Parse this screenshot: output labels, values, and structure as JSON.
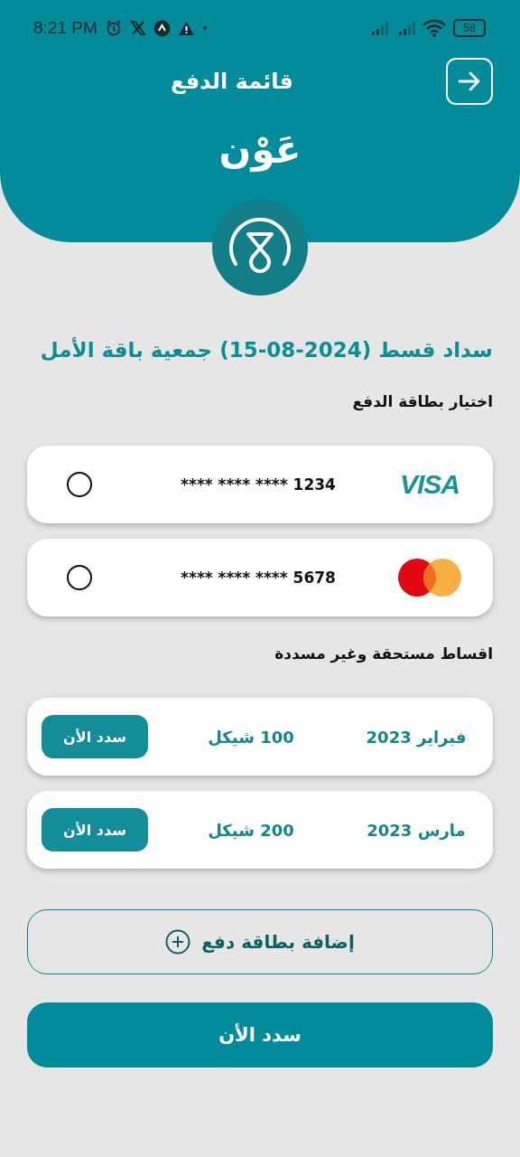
{
  "status_bar": {
    "time": "8:21 PM",
    "battery": "58"
  },
  "header": {
    "title": "قائمة الدفع",
    "logo_text": "عَوْن"
  },
  "payment_title": "سداد قسط (15-08-2024) جمعية باقة الأمل",
  "cards_heading": "اختيار بطاقة الدفع",
  "cards": [
    {
      "kind": "visa",
      "brand": "VISA",
      "number": "**** **** **** 1234",
      "selected": false
    },
    {
      "kind": "mastercard",
      "number": "**** **** **** 5678",
      "selected": false
    }
  ],
  "installments_heading": "اقساط مستحقة وغير مسددة",
  "installments": [
    {
      "month": "فبراير 2023",
      "amount": "100 شيكل",
      "button": "سدد الأن"
    },
    {
      "month": "مارس 2023",
      "amount": "200 شيكل",
      "button": "سدد الأن"
    }
  ],
  "add_card_button": "إضافة بطاقة دفع",
  "pay_button": "سدد الأن"
}
